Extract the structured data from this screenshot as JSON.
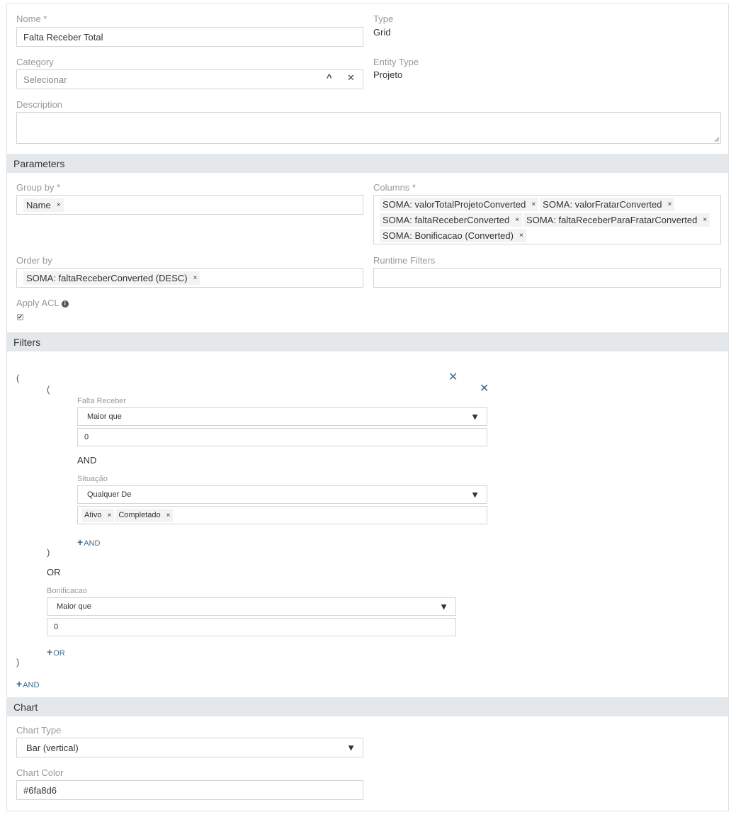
{
  "fields": {
    "name": {
      "label": "Nome *",
      "value": "Falta Receber Total"
    },
    "type": {
      "label": "Type",
      "value": "Grid"
    },
    "category": {
      "label": "Category",
      "placeholder": "Selecionar"
    },
    "entity_type": {
      "label": "Entity Type",
      "value": "Projeto"
    },
    "description": {
      "label": "Description",
      "value": ""
    }
  },
  "parameters": {
    "title": "Parameters",
    "group_by": {
      "label": "Group by *",
      "tags": [
        "Name"
      ]
    },
    "columns": {
      "label": "Columns *",
      "tags": [
        "SOMA: valorTotalProjetoConverted",
        "SOMA: valorFratarConverted",
        "SOMA: faltaReceberConverted",
        "SOMA: faltaReceberParaFratarConverted",
        "SOMA: Bonificacao (Converted)"
      ]
    },
    "order_by": {
      "label": "Order by",
      "tags": [
        "SOMA: faltaReceberConverted (DESC)"
      ]
    },
    "runtime_filters": {
      "label": "Runtime Filters"
    },
    "apply_acl": {
      "label": "Apply ACL",
      "checked": true
    }
  },
  "filters": {
    "title": "Filters",
    "open_paren": "(",
    "close_paren": ")",
    "inner_open_paren": "(",
    "inner_close_paren": ")",
    "falta_receber": {
      "label": "Falta Receber",
      "operator": "Maior que",
      "value": "0"
    },
    "and_label": "AND",
    "situacao": {
      "label": "Situação",
      "operator": "Qualquer De",
      "tags": [
        "Ativo",
        "Completado"
      ]
    },
    "add_and_inner": "AND",
    "or_label": "OR",
    "bonificacao": {
      "label": "Bonificacao",
      "operator": "Maior que",
      "value": "0"
    },
    "add_or": "OR",
    "add_and_outer": "AND"
  },
  "chart": {
    "title": "Chart",
    "chart_type": {
      "label": "Chart Type",
      "value": "Bar (vertical)"
    },
    "chart_color": {
      "label": "Chart Color",
      "value": "#6fa8d6"
    }
  },
  "icons": {
    "remove": "×",
    "clear": "✕",
    "caret_up": "^",
    "dropdown": "▼",
    "plus": "+",
    "info": "i",
    "check": "✔"
  },
  "colors": {
    "section_bg": "#e5e8ea",
    "link": "#3a6b8f",
    "border": "#d4d4d4"
  }
}
